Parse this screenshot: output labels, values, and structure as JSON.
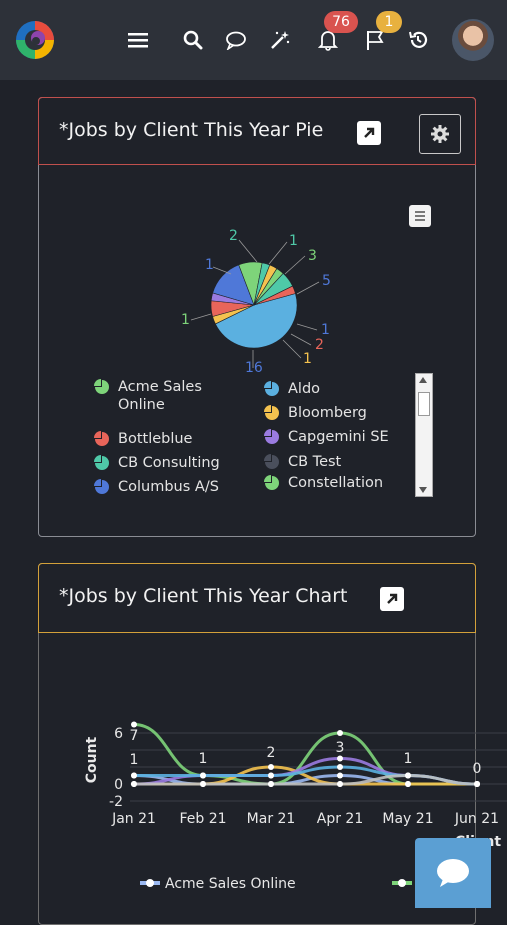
{
  "topbar": {
    "notifications_count": "76",
    "flags_count": "1",
    "icons": [
      "menu-icon",
      "search-icon",
      "chat-icon",
      "magic-wand-icon",
      "bell-icon",
      "flag-icon",
      "history-icon"
    ]
  },
  "panel_pie": {
    "title": "*Jobs by Client This Year Pie",
    "chart_data": {
      "type": "pie",
      "slice_labels": [
        "2",
        "1",
        "1",
        "1",
        "3",
        "5",
        "1",
        "2",
        "1",
        "16",
        "1"
      ],
      "legend": [
        {
          "label": "Acme Sales Online",
          "color": "#7ed47a"
        },
        {
          "label": "Aldo",
          "color": "#5bb0e0"
        },
        {
          "label": "Bottleblue",
          "color": "#e8655a"
        },
        {
          "label": "Bloomberg",
          "color": "#f4c24f"
        },
        {
          "label": "CB Consulting",
          "color": "#4fc9a8"
        },
        {
          "label": "Capgemini SE",
          "color": "#9a7be0"
        },
        {
          "label": "Columbus A/S",
          "color": "#4f78d8"
        },
        {
          "label": "CB Test",
          "color": "#4a4f5c"
        },
        {
          "label": "Constellation",
          "color": "#7ed47a"
        }
      ]
    }
  },
  "panel_chart": {
    "title": "*Jobs by Client This Year Chart",
    "chart_data": {
      "type": "line",
      "ylabel": "Count",
      "xlabel": "Client",
      "x": [
        "Jan 21",
        "Feb 21",
        "Mar 21",
        "Apr 21",
        "May 21",
        "Jun 21"
      ],
      "y_ticks": [
        "6",
        "0",
        "-2"
      ],
      "point_labels": [
        "7",
        "1",
        "1",
        "2",
        "3",
        "1",
        "0"
      ],
      "series": [
        {
          "name": "Acme Sales Online",
          "color": "#9ab8f0",
          "values": [
            1,
            0,
            0,
            1,
            0,
            0
          ]
        },
        {
          "name": "",
          "color": "#7ed47a",
          "values": [
            7,
            1,
            0,
            6,
            0,
            0
          ]
        },
        {
          "name": "",
          "color": "#f4c24f",
          "values": [
            0,
            0,
            2,
            0,
            0,
            0
          ]
        },
        {
          "name": "",
          "color": "#9a7be0",
          "values": [
            0,
            1,
            1,
            3,
            1,
            0
          ]
        },
        {
          "name": "",
          "color": "#5bb0e0",
          "values": [
            1,
            1,
            1,
            2,
            1,
            0
          ]
        },
        {
          "name": "",
          "color": "#c0c0c0",
          "values": [
            0,
            0,
            0,
            0,
            1,
            0
          ]
        }
      ]
    }
  }
}
